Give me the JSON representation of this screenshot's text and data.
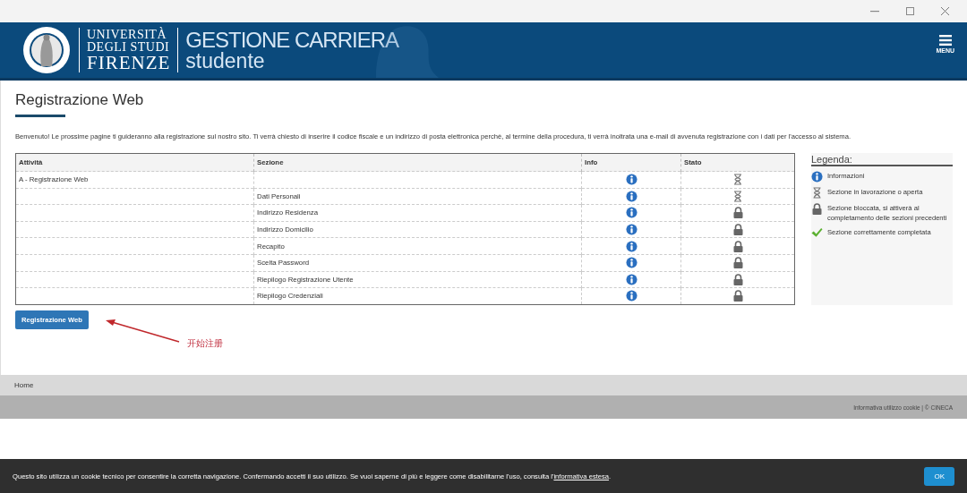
{
  "header": {
    "logo_lines": [
      "UNIVERSITÀ",
      "DEGLI STUDI",
      "FIRENZE"
    ],
    "app_title": "GESTIONE CARRIERA",
    "app_subtitle": "studente",
    "menu_label": "MENU"
  },
  "page": {
    "title": "Registrazione Web",
    "intro": "Benvenuto! Le prossime pagine ti guideranno alla registrazione sul nostro sito. Ti verrà chiesto di inserire il codice fiscale e un indirizzo di posta elettronica perchè, al termine della procedura, ti verrà inoltrata una e-mail di avvenuta registrazione con i dati per l'accesso al sistema."
  },
  "table": {
    "columns": [
      "Attività",
      "Sezione",
      "Info",
      "Stato"
    ],
    "rows": [
      {
        "activity": "A - Registrazione Web",
        "section": "",
        "kind": "hourglass"
      },
      {
        "activity": "",
        "section": "Dati Personali",
        "kind": "hourglass"
      },
      {
        "activity": "",
        "section": "Indirizzo Residenza",
        "kind": "lock"
      },
      {
        "activity": "",
        "section": "Indirizzo Domicilio",
        "kind": "lock"
      },
      {
        "activity": "",
        "section": "Recapito",
        "kind": "lock"
      },
      {
        "activity": "",
        "section": "Scelta Password",
        "kind": "lock"
      },
      {
        "activity": "",
        "section": "Riepilogo Registrazione Utente",
        "kind": "lock"
      },
      {
        "activity": "",
        "section": "Riepilogo Credenziali",
        "kind": "lock"
      }
    ]
  },
  "legend": {
    "title": "Legenda:",
    "items": [
      {
        "kind": "info",
        "text": "Informazioni"
      },
      {
        "kind": "hourglass",
        "text": "Sezione in lavorazione o aperta"
      },
      {
        "kind": "lock",
        "text": "Sezione bloccata, si attiverà al completamento delle sezioni precedenti"
      },
      {
        "kind": "check",
        "text": "Sezione correttamente completata"
      }
    ]
  },
  "button": "Registrazione Web",
  "annotation": "开始注册",
  "breadcrumb": "Home",
  "footer": "Informativa utilizzo cookie | © CINECA",
  "cookie_bar": {
    "text": "Questo sito utilizza un cookie tecnico per consentire la corretta navigazione. Confermando accetti il suo utilizzo. Se vuoi saperne di più e leggere come disabilitarne l'uso, consulta l'",
    "link": "informativa estesa",
    "text_after": ".",
    "ok": "OK"
  }
}
